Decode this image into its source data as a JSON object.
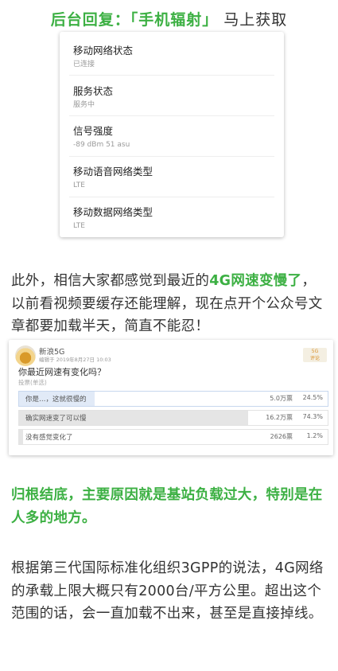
{
  "header": {
    "prefix": "后台回复：",
    "keyword": "「手机辐射」",
    "suffix": " 马上获取"
  },
  "status_card": {
    "items": [
      {
        "title": "移动网络状态",
        "value": "已连接"
      },
      {
        "title": "服务状态",
        "value": "服务中"
      },
      {
        "title": "信号强度",
        "value": "-89 dBm 51 asu"
      },
      {
        "title": "移动语音网络类型",
        "value": "LTE"
      },
      {
        "title": "移动数据网络类型",
        "value": "LTE"
      }
    ]
  },
  "para1": {
    "p1": "此外，相信大家都感觉到最近的",
    "hl": "4G网速变慢了",
    "p2": "，以前看视频要缓存还能理解，现在点开个公众号文章都要加载半天，简直不能忍！"
  },
  "poll": {
    "name": "新浪5G",
    "meta": "编辑于 2019年8月27日 10:03",
    "badge": "5G\n评论",
    "question": "你最近网速有变化吗？",
    "type": "投票(单选)",
    "options": [
      {
        "label": "你是…，这就很慢的",
        "count": "5.0万票",
        "pct": "24.5%",
        "fraction": 0.245,
        "selected": true
      },
      {
        "label": "确实网速变了可以慢",
        "count": "16.2万票",
        "pct": "74.3%",
        "fraction": 0.743,
        "selected": false
      },
      {
        "label": "没有感觉变化了",
        "count": "2626票",
        "pct": "1.2%",
        "fraction": 0.012,
        "selected": false
      }
    ]
  },
  "para2": {
    "text": "归根结底，主要原因就是基站负载过大，特别是在人多的地方。",
    "color": "#3cb043"
  },
  "para3": {
    "text": "根据第三代国际标准化组织3GPP的说法，4G网络的承载上限大概只有2000台/平方公里。超出这个范围的话，会一直加载不出来，甚至是直接掉线。"
  }
}
